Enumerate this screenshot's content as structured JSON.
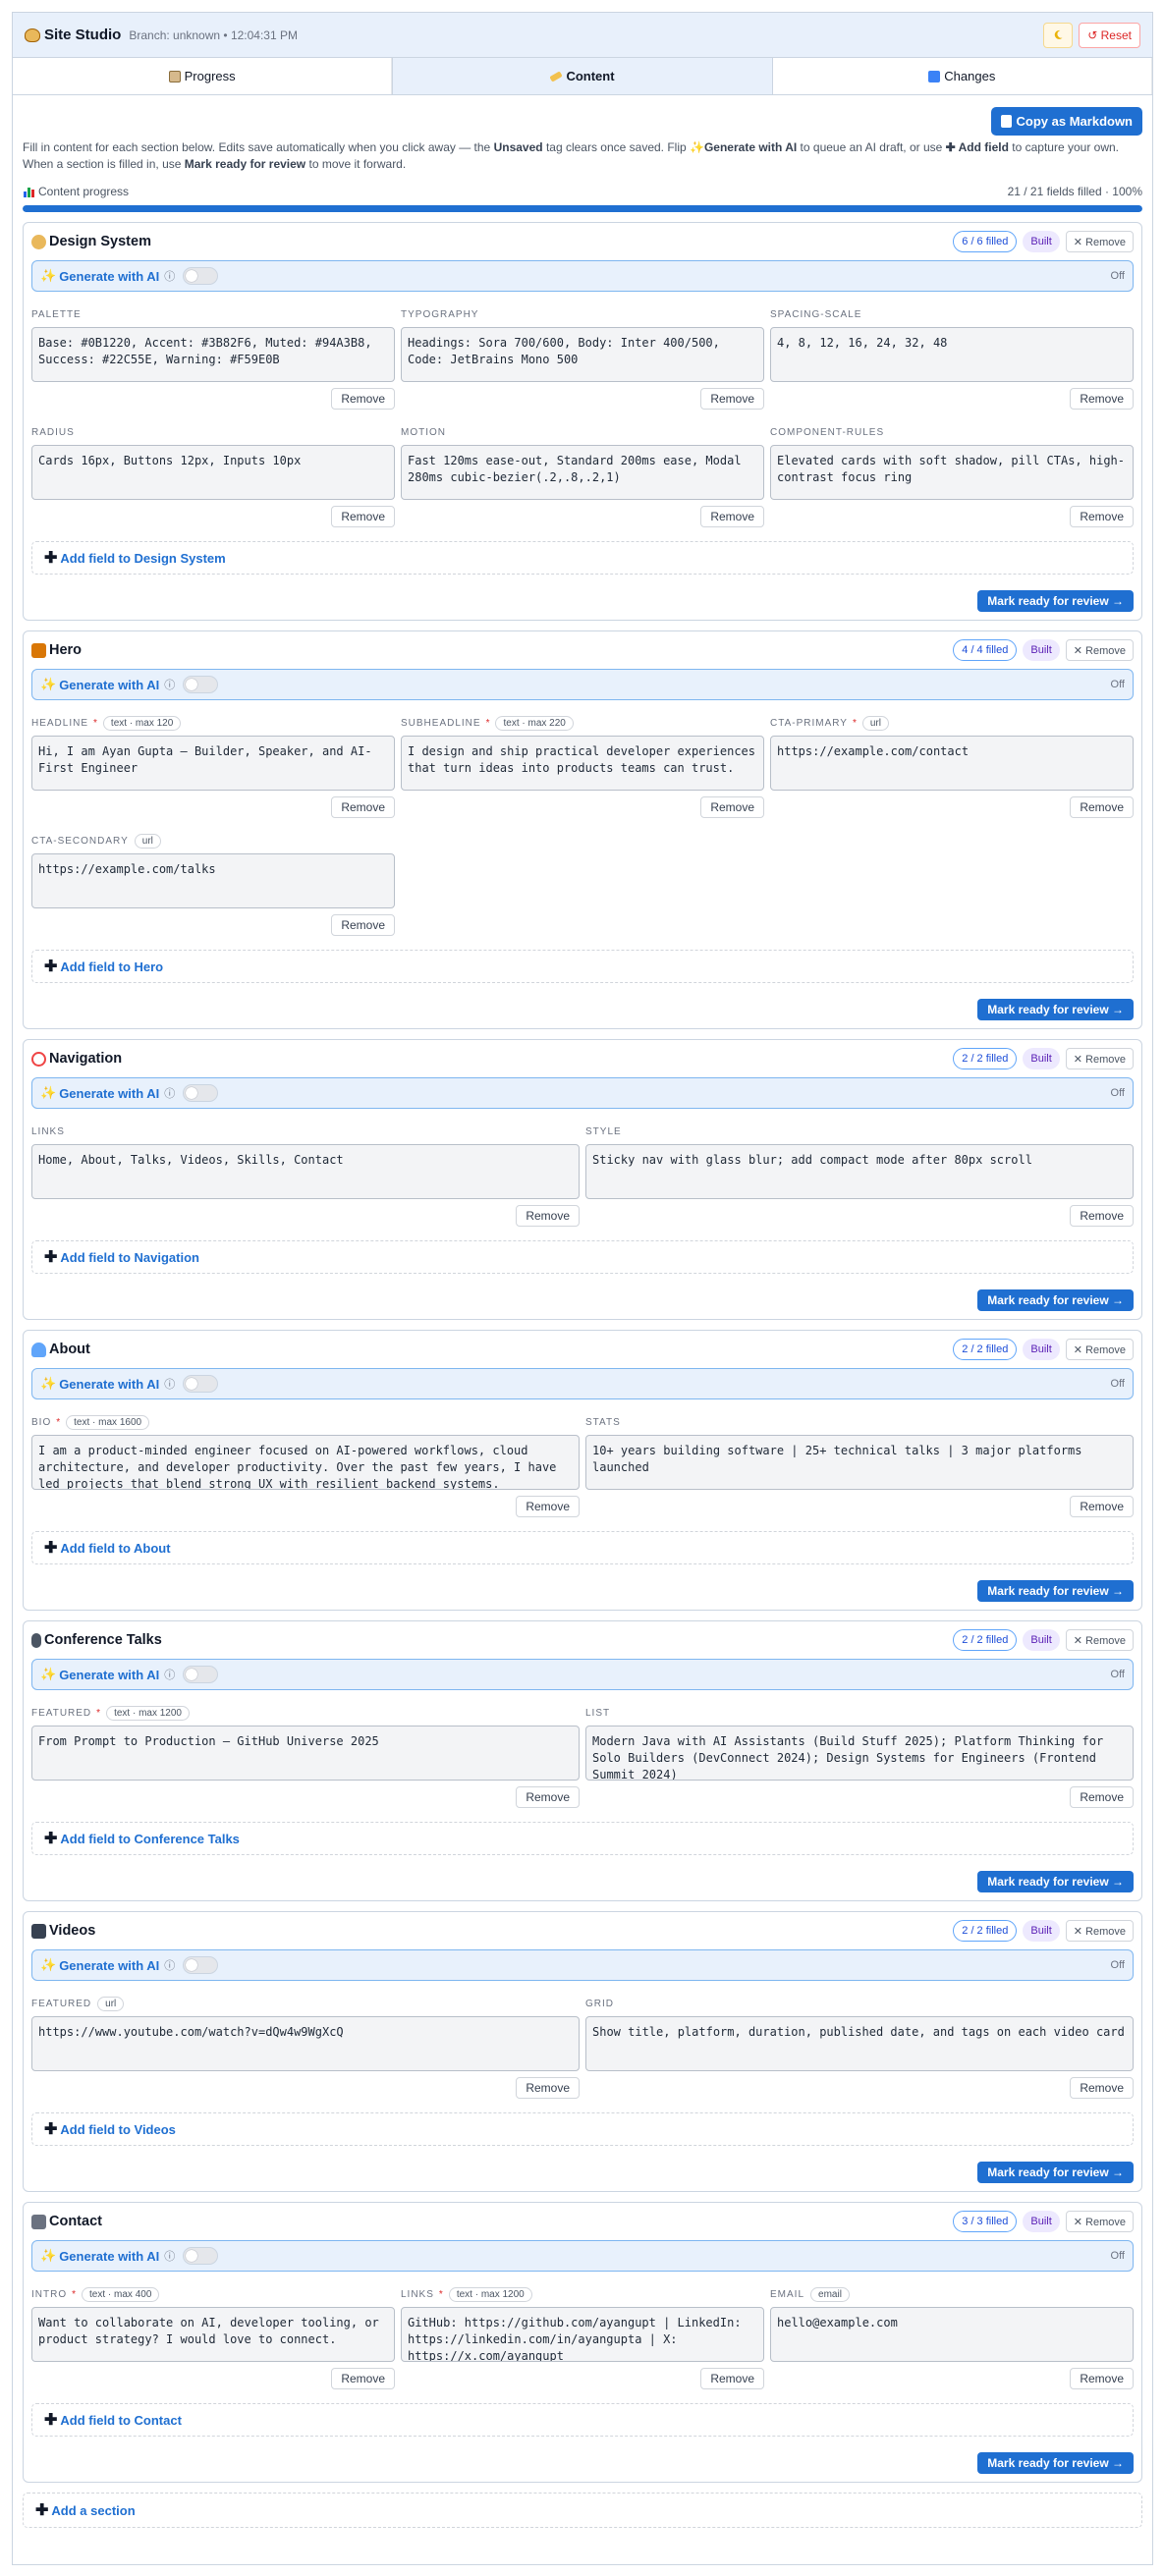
{
  "header": {
    "title": "Site Studio",
    "meta": "Branch: unknown • 12:04:31 PM",
    "theme_icon": "moon-icon",
    "reset_label": "↺ Reset"
  },
  "tabs": [
    {
      "label": "Progress",
      "icon": "clipboard-icon"
    },
    {
      "label": "Content",
      "icon": "pencil-icon"
    },
    {
      "label": "Changes",
      "icon": "refresh-icon"
    }
  ],
  "copy_markdown": "Copy as Markdown",
  "intro": {
    "p1": "Fill in content for each section below. Edits save automatically when you click away — the ",
    "unsaved": "Unsaved",
    "p2": " tag clears once saved. Flip ✨",
    "gen": "Generate with AI",
    "p3": " to queue an AI draft, or use ",
    "addfield": "Add field",
    "p4": " to capture your own. When a section is filled in, use ",
    "mark": "Mark ready for review",
    "p5": " to move it forward."
  },
  "progress": {
    "label": "Content progress",
    "summary": "21 / 21 fields filled · 100%",
    "fraction": 1.0
  },
  "common": {
    "ai_label": "Generate with AI",
    "ai_info": "ⓘ",
    "ai_state": "Off",
    "remove": "Remove",
    "remove_section": "✕ Remove",
    "built": "Built",
    "mark_ready": "Mark ready for review →",
    "add_section": "Add a section"
  },
  "sections": [
    {
      "title": "Design System",
      "icon": "palette-icon",
      "filled": "6 / 6 filled",
      "add_field": "Add field to Design System",
      "cols": 3,
      "fields": [
        {
          "label": "PALETTE",
          "required": false,
          "hint": "",
          "value": "Base: #0B1220, Accent: #3B82F6, Muted: #94A3B8, Success: #22C55E, Warning: #F59E0B"
        },
        {
          "label": "TYPOGRAPHY",
          "required": false,
          "hint": "",
          "value": "Headings: Sora 700/600, Body: Inter 400/500, Code: JetBrains Mono 500"
        },
        {
          "label": "SPACING-SCALE",
          "required": false,
          "hint": "",
          "value": "4, 8, 12, 16, 24, 32, 48"
        },
        {
          "label": "RADIUS",
          "required": false,
          "hint": "",
          "value": "Cards 16px, Buttons 12px, Inputs 10px"
        },
        {
          "label": "MOTION",
          "required": false,
          "hint": "",
          "value": "Fast 120ms ease-out, Standard 200ms ease, Modal 280ms cubic-bezier(.2,.8,.2,1)"
        },
        {
          "label": "COMPONENT-RULES",
          "required": false,
          "hint": "",
          "value": "Elevated cards with soft shadow, pill CTAs, high-contrast focus ring"
        }
      ]
    },
    {
      "title": "Hero",
      "icon": "house-icon",
      "filled": "4 / 4 filled",
      "add_field": "Add field to Hero",
      "cols": 3,
      "fields": [
        {
          "label": "HEADLINE",
          "required": true,
          "hint": "text · max 120",
          "value": "Hi, I am Ayan Gupta — Builder, Speaker, and AI-First Engineer"
        },
        {
          "label": "SUBHEADLINE",
          "required": true,
          "hint": "text · max 220",
          "value": "I design and ship practical developer experiences that turn ideas into products teams can trust."
        },
        {
          "label": "CTA-PRIMARY",
          "required": true,
          "hint": "url",
          "value": "https://example.com/contact"
        },
        {
          "label": "CTA-SECONDARY",
          "required": false,
          "hint": "url",
          "value": "https://example.com/talks"
        }
      ]
    },
    {
      "title": "Navigation",
      "icon": "compass-icon",
      "filled": "2 / 2 filled",
      "add_field": "Add field to Navigation",
      "cols": 2,
      "fields": [
        {
          "label": "LINKS",
          "required": false,
          "hint": "",
          "value": "Home, About, Talks, Videos, Skills, Contact"
        },
        {
          "label": "STYLE",
          "required": false,
          "hint": "",
          "value": "Sticky nav with glass blur; add compact mode after 80px scroll"
        }
      ]
    },
    {
      "title": "About",
      "icon": "person-icon",
      "filled": "2 / 2 filled",
      "add_field": "Add field to About",
      "cols": 2,
      "fields": [
        {
          "label": "BIO",
          "required": true,
          "hint": "text · max 1600",
          "value": "I am a product-minded engineer focused on AI-powered workflows, cloud architecture, and developer productivity. Over the past few years, I have led projects that blend strong UX with resilient backend systems."
        },
        {
          "label": "STATS",
          "required": false,
          "hint": "",
          "value": "10+ years building software | 25+ technical talks | 3 major platforms launched"
        }
      ]
    },
    {
      "title": "Conference Talks",
      "icon": "microphone-icon",
      "filled": "2 / 2 filled",
      "add_field": "Add field to Conference Talks",
      "cols": 2,
      "fields": [
        {
          "label": "FEATURED",
          "required": true,
          "hint": "text · max 1200",
          "value": "From Prompt to Production — GitHub Universe 2025"
        },
        {
          "label": "LIST",
          "required": false,
          "hint": "",
          "value": "Modern Java with AI Assistants (Build Stuff 2025); Platform Thinking for Solo Builders (DevConnect 2024); Design Systems for Engineers (Frontend Summit 2024)"
        }
      ]
    },
    {
      "title": "Videos",
      "icon": "video-camera-icon",
      "filled": "2 / 2 filled",
      "add_field": "Add field to Videos",
      "cols": 2,
      "fields": [
        {
          "label": "FEATURED",
          "required": false,
          "hint": "url",
          "value": "https://www.youtube.com/watch?v=dQw4w9WgXcQ"
        },
        {
          "label": "GRID",
          "required": false,
          "hint": "",
          "value": "Show title, platform, duration, published date, and tags on each video card"
        }
      ]
    },
    {
      "title": "Contact",
      "icon": "mailbox-icon",
      "filled": "3 / 3 filled",
      "add_field": "Add field to Contact",
      "cols": 3,
      "fields": [
        {
          "label": "INTRO",
          "required": true,
          "hint": "text · max 400",
          "value": "Want to collaborate on AI, developer tooling, or product strategy? I would love to connect."
        },
        {
          "label": "LINKS",
          "required": true,
          "hint": "text · max 1200",
          "value": "GitHub: https://github.com/ayangupt | LinkedIn: https://linkedin.com/in/ayangupta | X: https://x.com/ayangupt"
        },
        {
          "label": "EMAIL",
          "required": false,
          "hint": "email",
          "value": "hello@example.com"
        }
      ]
    }
  ]
}
